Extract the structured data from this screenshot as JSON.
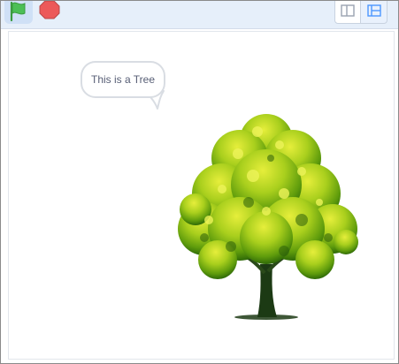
{
  "toolbar": {
    "green_flag": {
      "icon": "green-flag-icon",
      "color": "#4cbf56"
    },
    "stop": {
      "icon": "stop-sign-icon",
      "color": "#ec5959"
    },
    "stage_size": {
      "small_icon": "small-stage-icon",
      "large_icon": "large-stage-icon",
      "accent": "#4c97ff"
    }
  },
  "stage": {
    "speech_bubble": {
      "text": "This is a Tree"
    },
    "sprite": {
      "name": "tree-sprite",
      "trunk_color": "#1c3a14",
      "foliage_color": "#78b10e"
    }
  }
}
